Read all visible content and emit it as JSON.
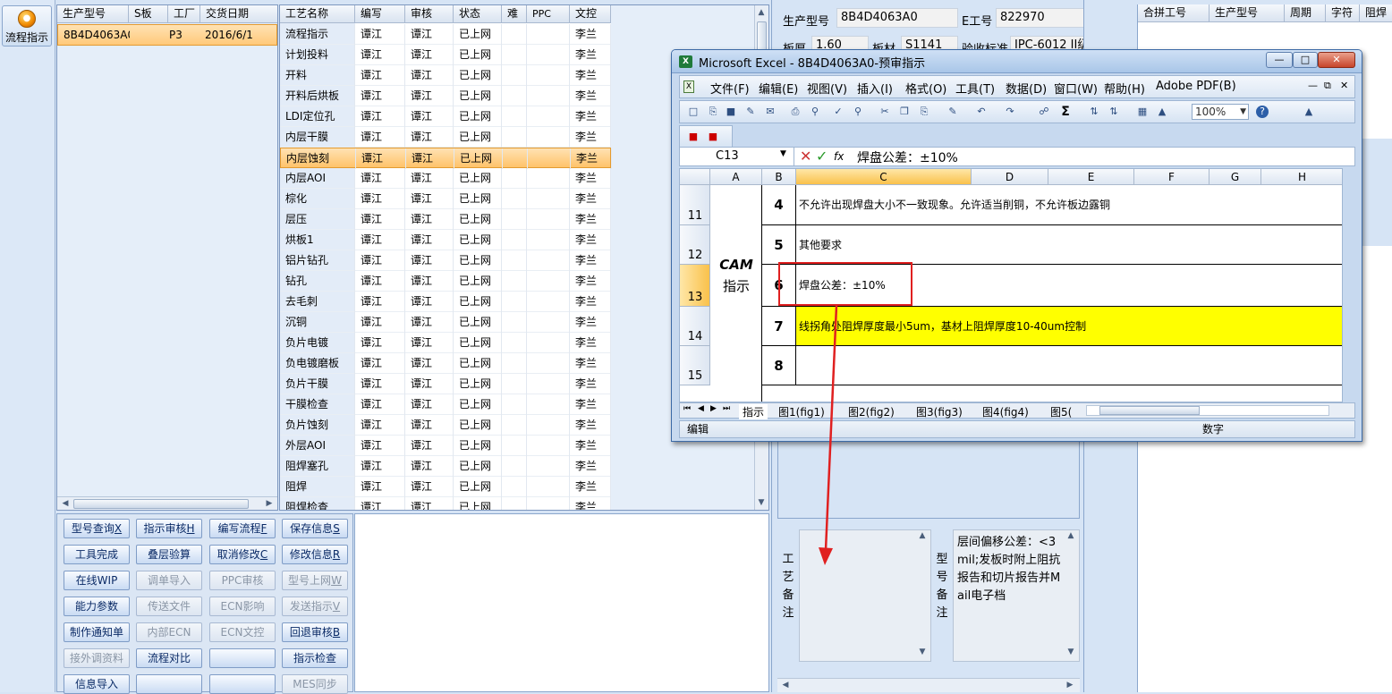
{
  "launcher": {
    "label": "流程指示"
  },
  "model_grid": {
    "columns": [
      "生产型号",
      "S板",
      "工厂",
      "交货日期"
    ],
    "rows": [
      [
        "8B4D4063A0",
        "",
        "P3",
        "2016/6/1"
      ]
    ]
  },
  "process_grid": {
    "columns": [
      "工艺名称",
      "编写",
      "审核",
      "状态",
      "难",
      "PPC",
      "文控"
    ],
    "rows": [
      [
        "流程指示",
        "谭江",
        "谭江",
        "已上网",
        "",
        "",
        "李兰"
      ],
      [
        "计划投料",
        "谭江",
        "谭江",
        "已上网",
        "",
        "",
        "李兰"
      ],
      [
        "开料",
        "谭江",
        "谭江",
        "已上网",
        "",
        "",
        "李兰"
      ],
      [
        "开料后烘板",
        "谭江",
        "谭江",
        "已上网",
        "",
        "",
        "李兰"
      ],
      [
        "LDI定位孔",
        "谭江",
        "谭江",
        "已上网",
        "",
        "",
        "李兰"
      ],
      [
        "内层干膜",
        "谭江",
        "谭江",
        "已上网",
        "",
        "",
        "李兰"
      ],
      [
        "内层蚀刻",
        "谭江",
        "谭江",
        "已上网",
        "",
        "",
        "李兰"
      ],
      [
        "内层AOI",
        "谭江",
        "谭江",
        "已上网",
        "",
        "",
        "李兰"
      ],
      [
        "棕化",
        "谭江",
        "谭江",
        "已上网",
        "",
        "",
        "李兰"
      ],
      [
        "层压",
        "谭江",
        "谭江",
        "已上网",
        "",
        "",
        "李兰"
      ],
      [
        "烘板1",
        "谭江",
        "谭江",
        "已上网",
        "",
        "",
        "李兰"
      ],
      [
        "铝片钻孔",
        "谭江",
        "谭江",
        "已上网",
        "",
        "",
        "李兰"
      ],
      [
        "钻孔",
        "谭江",
        "谭江",
        "已上网",
        "",
        "",
        "李兰"
      ],
      [
        "去毛刺",
        "谭江",
        "谭江",
        "已上网",
        "",
        "",
        "李兰"
      ],
      [
        "沉铜",
        "谭江",
        "谭江",
        "已上网",
        "",
        "",
        "李兰"
      ],
      [
        "负片电镀",
        "谭江",
        "谭江",
        "已上网",
        "",
        "",
        "李兰"
      ],
      [
        "负电镀磨板",
        "谭江",
        "谭江",
        "已上网",
        "",
        "",
        "李兰"
      ],
      [
        "负片干膜",
        "谭江",
        "谭江",
        "已上网",
        "",
        "",
        "李兰"
      ],
      [
        "干膜检查",
        "谭江",
        "谭江",
        "已上网",
        "",
        "",
        "李兰"
      ],
      [
        "负片蚀刻",
        "谭江",
        "谭江",
        "已上网",
        "",
        "",
        "李兰"
      ],
      [
        "外层AOI",
        "谭江",
        "谭江",
        "已上网",
        "",
        "",
        "李兰"
      ],
      [
        "阻焊塞孔",
        "谭江",
        "谭江",
        "已上网",
        "",
        "",
        "李兰"
      ],
      [
        "阻焊",
        "谭江",
        "谭江",
        "已上网",
        "",
        "",
        "李兰"
      ],
      [
        "阻焊检查",
        "谭江",
        "谭江",
        "已上网",
        "",
        "",
        "李兰"
      ]
    ],
    "selected_row": 6
  },
  "action_buttons": [
    {
      "label": "型号查询",
      "key": "X",
      "enabled": true
    },
    {
      "label": "指示审核",
      "key": "H",
      "enabled": true
    },
    {
      "label": "编写流程",
      "key": "F",
      "enabled": true
    },
    {
      "label": "保存信息",
      "key": "S",
      "enabled": true
    },
    {
      "label": "工具完成",
      "key": "",
      "enabled": true
    },
    {
      "label": "叠层验算",
      "key": "",
      "enabled": true
    },
    {
      "label": "取消修改",
      "key": "C",
      "enabled": true
    },
    {
      "label": "修改信息",
      "key": "R",
      "enabled": true
    },
    {
      "label": "在线WIP",
      "key": "",
      "enabled": true
    },
    {
      "label": "调单导入",
      "key": "",
      "enabled": false
    },
    {
      "label": "PPC审核",
      "key": "",
      "enabled": false
    },
    {
      "label": "型号上网",
      "key": "W",
      "enabled": false
    },
    {
      "label": "能力参数",
      "key": "",
      "enabled": true
    },
    {
      "label": "传送文件",
      "key": "",
      "enabled": false
    },
    {
      "label": "ECN影响",
      "key": "",
      "enabled": false
    },
    {
      "label": "发送指示",
      "key": "V",
      "enabled": false
    },
    {
      "label": "制作通知单",
      "key": "",
      "enabled": true
    },
    {
      "label": "内部ECN",
      "key": "",
      "enabled": false
    },
    {
      "label": "ECN文控",
      "key": "",
      "enabled": false
    },
    {
      "label": "回退审核",
      "key": "B",
      "enabled": true
    },
    {
      "label": "接外调资料",
      "key": "",
      "enabled": false
    },
    {
      "label": "流程对比",
      "key": "",
      "enabled": true
    },
    {
      "label": "",
      "key": "",
      "enabled": true
    },
    {
      "label": "指示检查",
      "key": "",
      "enabled": true
    },
    {
      "label": "信息导入",
      "key": "",
      "enabled": true
    },
    {
      "label": "",
      "key": "",
      "enabled": true
    },
    {
      "label": "",
      "key": "",
      "enabled": true
    },
    {
      "label": "MES同步",
      "key": "",
      "enabled": false
    }
  ],
  "info": {
    "model_label": "生产型号",
    "model_value": "8B4D4063A0",
    "e_label": "E工号",
    "e_value": "822970",
    "thickness_label": "板厚",
    "thickness_value": "1.60",
    "material_label": "板材",
    "material_value": "S1141",
    "standard_label": "验收标准",
    "standard_value": "IPC-6012 II级",
    "process_note_label": "工艺备注",
    "model_note_label": "型号备注",
    "model_note_value": "层间偏移公差：<3mil;发板时附上阻抗报告和切片报告并Mail电子档"
  },
  "right_grid": {
    "columns": [
      "合拼工号",
      "生产型号",
      "周期",
      "字符",
      "阻焊"
    ]
  },
  "excel": {
    "title": "Microsoft Excel - 8B4D4063A0-预审指示",
    "menus": [
      "文件(F)",
      "编辑(E)",
      "视图(V)",
      "插入(I)",
      "格式(O)",
      "工具(T)",
      "数据(D)",
      "窗口(W)",
      "帮助(H)",
      "Adobe PDF(B)"
    ],
    "zoom": "100%",
    "name_box": "C13",
    "formula": "焊盘公差：±10%",
    "columns": [
      "A",
      "B",
      "C",
      "D",
      "E",
      "F",
      "G",
      "H"
    ],
    "section_label_1": "CAM",
    "section_label_2": "指示",
    "rows": [
      {
        "num": "11",
        "b": "4",
        "c": "不允许出现焊盘大小不一致现象。允许适当削铜，不允许板边露铜",
        "highlight": false
      },
      {
        "num": "12",
        "b": "5",
        "c": "其他要求",
        "highlight": false
      },
      {
        "num": "13",
        "b": "6",
        "c": "焊盘公差：±10%",
        "highlight": false
      },
      {
        "num": "14",
        "b": "7",
        "c": "线拐角处阻焊厚度最小5um，基材上阻焊厚度10-40um控制",
        "highlight": true
      },
      {
        "num": "15",
        "b": "8",
        "c": "",
        "highlight": false
      }
    ],
    "sheet_tabs": [
      "指示",
      "图1(fig1)",
      "图2(fig2)",
      "图3(fig3)",
      "图4(fig4)",
      "图5("
    ],
    "status_left": "编辑",
    "status_right": "数字"
  },
  "colors": {
    "accent": "#ffc97a",
    "highlight_yellow": "#ffff00",
    "annotation_red": "#e02020"
  }
}
